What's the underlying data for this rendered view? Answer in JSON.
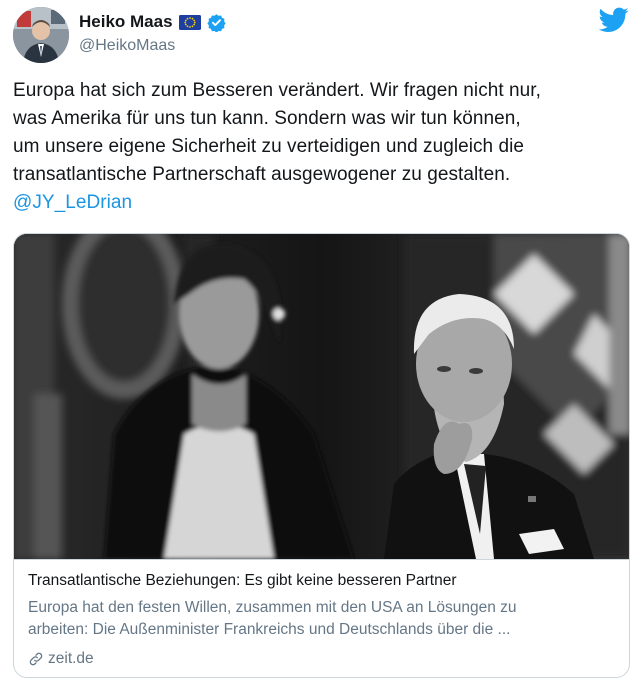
{
  "author": {
    "display_name": "Heiko Maas",
    "handle": "@HeikoMaas"
  },
  "icons": {
    "flag": "eu-flag-icon",
    "verified": "verified-badge-icon",
    "brand": "twitter-bird-icon",
    "link": "link-icon"
  },
  "colors": {
    "twitter_blue": "#1da1f2",
    "link_blue": "#1b95e0",
    "secondary_text": "#657786",
    "border": "#ccd6dd"
  },
  "tweet": {
    "lines": [
      "Europa hat sich zum Besseren verändert. Wir fragen nicht nur,",
      "was Amerika für uns tun kann. Sondern was wir tun können,",
      "um unsere eigene Sicherheit zu verteidigen und zugleich die",
      "transatlantische Partnerschaft ausgewogener zu gestalten."
    ],
    "mention": "@JY_LeDrian"
  },
  "card": {
    "title": "Transatlantische Beziehungen: Es gibt keine besseren Partner",
    "description_lines": [
      "Europa hat den festen Willen, zusammen mit den USA an Lösungen zu",
      "arbeiten: Die Außenminister Frankreichs und Deutschlands über die ..."
    ],
    "domain": "zeit.de"
  }
}
